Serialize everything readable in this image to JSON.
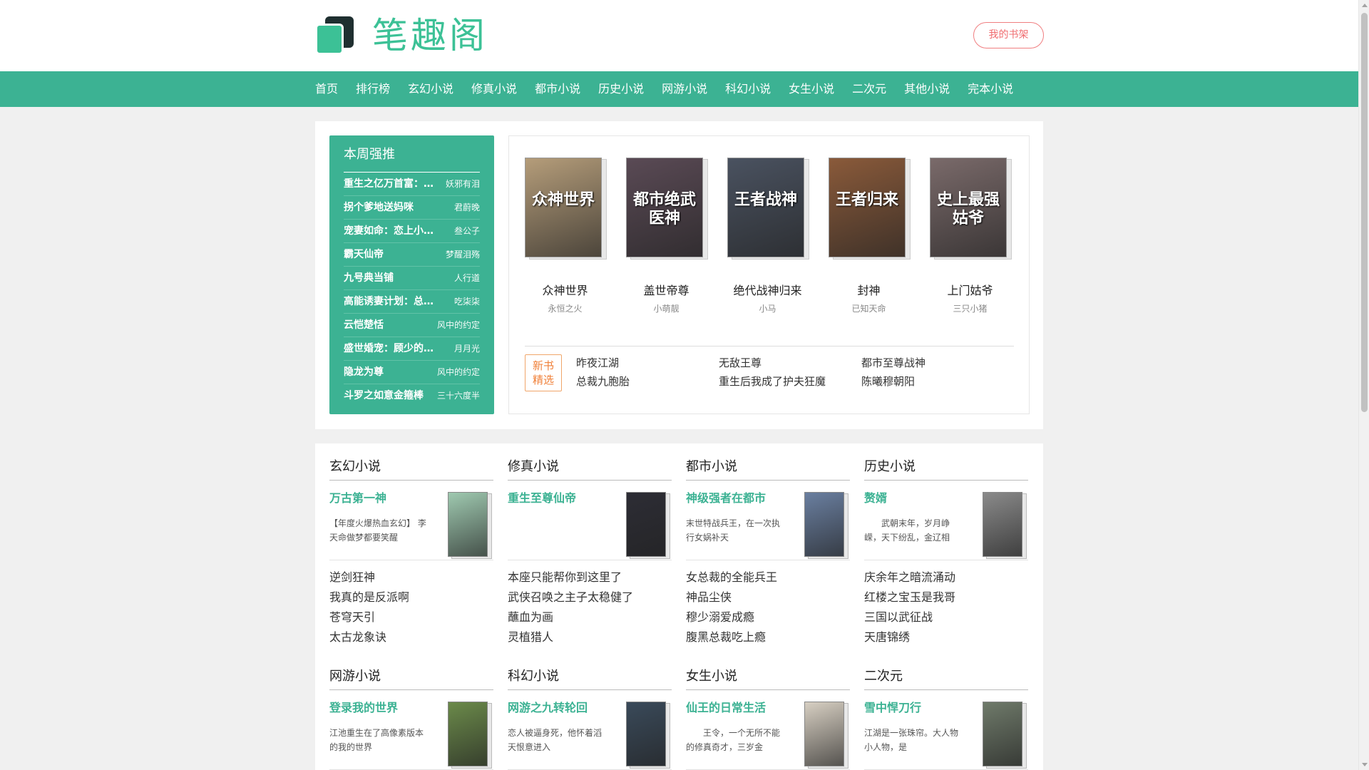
{
  "header": {
    "logo_text": "笔趣阁",
    "shelf_label": "我的书架"
  },
  "nav": [
    "首页",
    "排行榜",
    "玄幻小说",
    "修真小说",
    "都市小说",
    "历史小说",
    "网游小说",
    "科幻小说",
    "女生小说",
    "二次元",
    "其他小说",
    "完本小说"
  ],
  "weekly": {
    "title": "本周强推",
    "items": [
      {
        "name": "重生之亿万首富：总裁小娇妻",
        "author": "妖邪有泪"
      },
      {
        "name": "拐个爹地送妈咪",
        "author": "君蔚晚"
      },
      {
        "name": "宠妻如命：恋上小娇妻",
        "author": "叁公子"
      },
      {
        "name": "霸天仙帝",
        "author": "梦醒泪殇"
      },
      {
        "name": "九号典当铺",
        "author": "人行道"
      },
      {
        "name": "高能诱妻计划：总裁的",
        "author": "吃柒柒"
      },
      {
        "name": "云恺楚恬",
        "author": "风中的约定"
      },
      {
        "name": "盛世婚宠：顾少的心头",
        "author": "月月光"
      },
      {
        "name": "隐龙为尊",
        "author": "风中的约定"
      },
      {
        "name": "斗罗之如意金箍棒",
        "author": "三十六度半"
      }
    ]
  },
  "featured": [
    {
      "title": "众神世界",
      "author": "永恒之火",
      "cover_text": "众神世界",
      "cover_color": "#b59d7a"
    },
    {
      "title": "盖世帝尊",
      "author": "小萌靓",
      "cover_text": "都市绝武医神",
      "cover_color": "#5a4a55"
    },
    {
      "title": "绝代战神归来",
      "author": "小马",
      "cover_text": "王者战神",
      "cover_color": "#4a5260"
    },
    {
      "title": "封神",
      "author": "已知天命",
      "cover_text": "王者归来",
      "cover_color": "#8a5a3a"
    },
    {
      "title": "上门姑爷",
      "author": "三只小猪",
      "cover_text": "史上最强姑爷",
      "cover_color": "#7a6a6a"
    }
  ],
  "new_books": {
    "badge_line1": "新书",
    "badge_line2": "精选",
    "items": [
      "昨夜江湖",
      "无敌王尊",
      "都市至尊战神",
      "总裁九胞胎",
      "重生后我成了护夫狂魔",
      "陈曦穆朝阳"
    ]
  },
  "categories": [
    {
      "title": "玄幻小说",
      "top": "万古第一神",
      "desc": "【年度火爆热血玄幻】 李天命做梦都要笑醒",
      "cover_color": "#9fc9b0",
      "list": [
        "逆剑狂神",
        "我真的是反派啊",
        "苍穹天引",
        "太古龙象诀"
      ]
    },
    {
      "title": "修真小说",
      "top": "重生至尊仙帝",
      "desc": "",
      "cover_color": "#2d2d35",
      "list": [
        "本座只能帮你到这里了",
        "武侠召唤之主子太稳健了",
        "蘸血为画",
        "灵植猎人"
      ]
    },
    {
      "title": "都市小说",
      "top": "神级强者在都市",
      "desc": "末世特战兵王，在一次执行女娲补天",
      "cover_color": "#6a7fa0",
      "list": [
        "女总裁的全能兵王",
        "神品尘侠",
        "穆少溺爱成瘾",
        "腹黑总裁吃上瘾"
      ]
    },
    {
      "title": "历史小说",
      "top": "赘婿",
      "desc": "　　武朝末年，岁月峥嵘，天下纷乱，金辽相",
      "cover_color": "#8a8a8a",
      "list": [
        "庆余年之暗流涌动",
        "红楼之宝玉是我哥",
        "三国以武征战",
        "天唐锦绣"
      ]
    },
    {
      "title": "网游小说",
      "top": "登录我的世界",
      "desc": "江池重生在了高像素版本的我的世界",
      "cover_color": "#6b8a4a",
      "list": []
    },
    {
      "title": "科幻小说",
      "top": "网游之九转轮回",
      "desc": "恋人被逼身死，他怀着滔天恨意进入",
      "cover_color": "#3a4a5a",
      "list": []
    },
    {
      "title": "女生小说",
      "top": "仙王的日常生活",
      "desc": "　　王令，一个无所不能的修真奇才，三岁金",
      "cover_color": "#d7cfc2",
      "list": []
    },
    {
      "title": "二次元",
      "top": "雪中悍刀行",
      "desc": "江湖是一张珠帘。大人物小人物，是",
      "cover_color": "#6f7a6a",
      "list": []
    }
  ]
}
